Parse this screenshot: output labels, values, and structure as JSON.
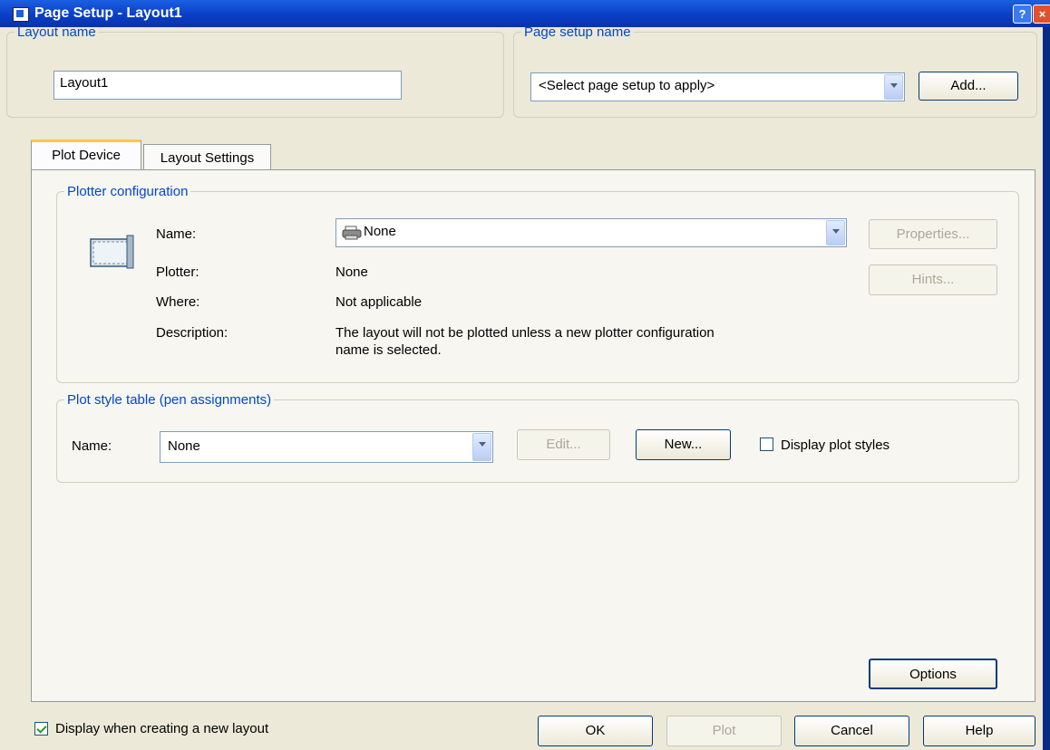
{
  "window": {
    "title": "Page Setup - Layout1"
  },
  "layout_name": {
    "legend": "Layout name",
    "value": "Layout1"
  },
  "page_setup_name": {
    "legend": "Page setup name",
    "selected": "<Select page setup to apply>",
    "add_label": "Add..."
  },
  "tabs": [
    {
      "label": "Plot Device",
      "active": true
    },
    {
      "label": "Layout Settings",
      "active": false
    }
  ],
  "plotter_config": {
    "legend": "Plotter configuration",
    "name_label": "Name:",
    "name_value": "None",
    "plotter_label": "Plotter:",
    "plotter_value": "None",
    "where_label": "Where:",
    "where_value": "Not applicable",
    "description_label": "Description:",
    "description_line1": "The layout will not be plotted unless a new plotter configuration",
    "description_line2": "name is selected.",
    "properties_label": "Properties...",
    "hints_label": "Hints..."
  },
  "plot_style": {
    "legend": "Plot style table (pen assignments)",
    "name_label": "Name:",
    "name_value": "None",
    "edit_label": "Edit...",
    "new_label": "New...",
    "display_label": "Display plot styles",
    "display_checked": false
  },
  "options_label": "Options",
  "footer": {
    "display_new_layout_label": "Display when creating a new layout",
    "display_new_layout_checked": true,
    "ok_label": "OK",
    "plot_label": "Plot",
    "cancel_label": "Cancel",
    "help_label": "Help"
  },
  "icons": {
    "app": "page-setup-icon",
    "plotter": "plotter-icon",
    "printer": "printer-icon"
  },
  "colors": {
    "title_bar": "#0a3fc8",
    "legend_text": "#0046d5",
    "dialog_bg": "#ece9d8"
  }
}
